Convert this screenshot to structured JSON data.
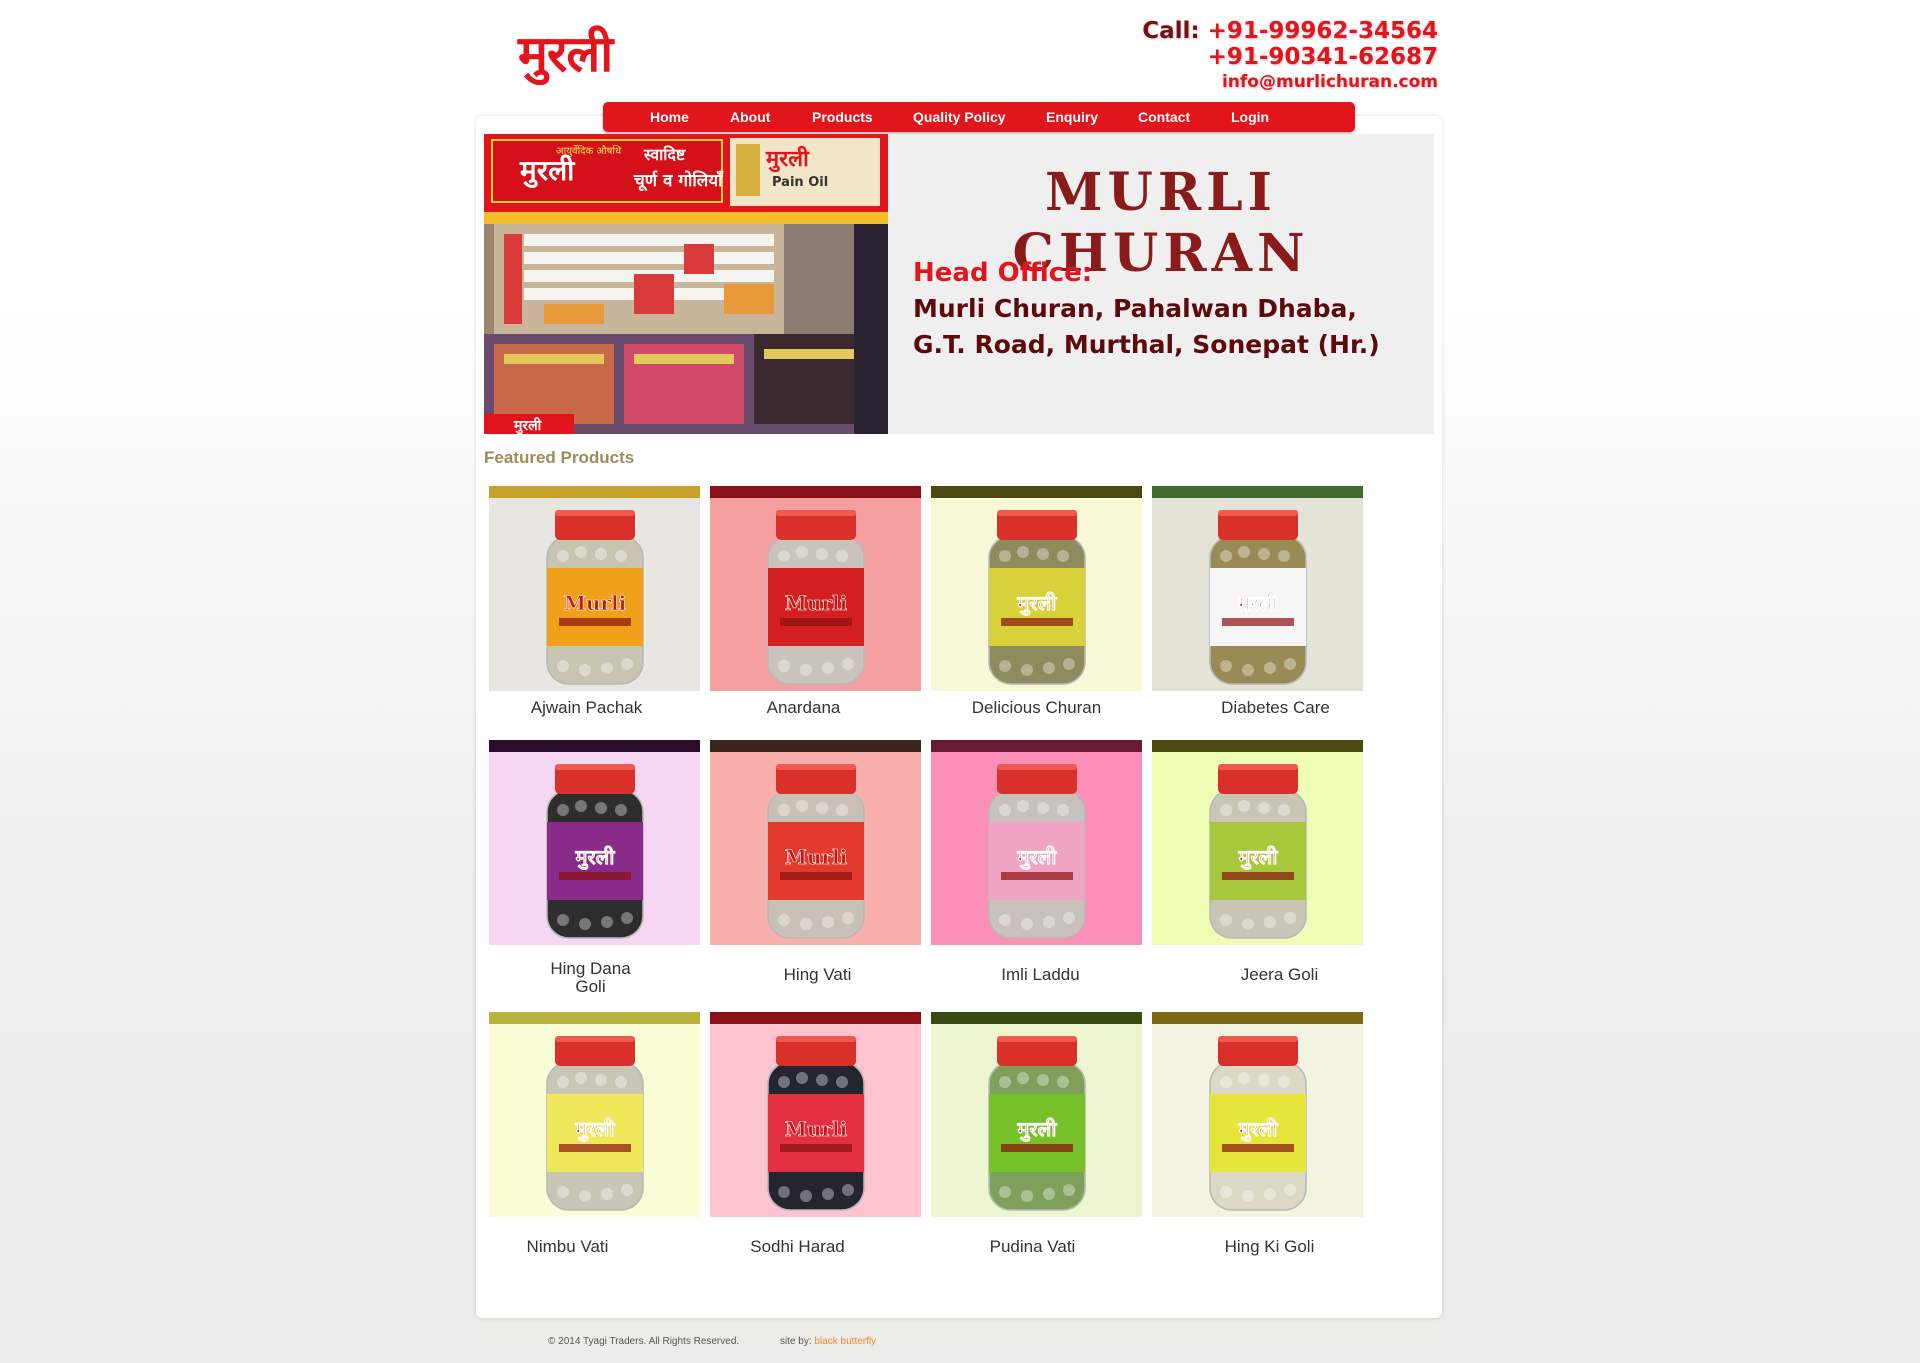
{
  "header": {
    "logo_text": "मुरली",
    "call_label": "Call:",
    "phone1": "+91-99962-34564",
    "phone2": "+91-90341-62687",
    "email": "info@murlichuran.com"
  },
  "nav": {
    "items": [
      {
        "label": "Home"
      },
      {
        "label": "About"
      },
      {
        "label": "Products"
      },
      {
        "label": "Quality Policy"
      },
      {
        "label": "Enquiry"
      },
      {
        "label": "Contact"
      },
      {
        "label": "Login"
      }
    ]
  },
  "banner": {
    "image_texts": [
      "आयुर्वेदिक औषधि",
      "मुरली",
      "स्वादिष्ट",
      "चूर्ण व गोलियाँ",
      "मुरली",
      "Pain Oil",
      "मुरली"
    ],
    "brand_title": "MURLI CHURAN",
    "office_label": "Head Office:",
    "office_line1": "Murli Churan, Pahalwan Dhaba,",
    "office_line2": "G.T. Road, Murthal, Sonepat (Hr.)"
  },
  "featured": {
    "heading": "Featured Products",
    "products": [
      {
        "name": "Ajwain Pachak",
        "label_text": "Murli",
        "stripe": "#c8a02c",
        "bg": "#e7e6e0",
        "label_color": "#f0a11a",
        "contents": "#c9c3b2"
      },
      {
        "name": "Anardana",
        "label_text": "Murli",
        "stripe": "#8c1018",
        "bg": "#f5a0a0",
        "label_color": "#d42020",
        "contents": "#c9c3bb"
      },
      {
        "name": "Delicious Churan",
        "label_text": "मुरली",
        "stripe": "#4d4a10",
        "bg": "#f9f8d6",
        "label_color": "#d7d23a",
        "contents": "#8e8b5c"
      },
      {
        "name": "Diabetes Care",
        "label_text": "मुरली",
        "stripe": "#3f6a30",
        "bg": "#e3e3d8",
        "label_color": "#f6f6f6",
        "contents": "#9a8b55"
      },
      {
        "name": "Hing Dana\nGoli",
        "label_text": "मुरली",
        "stripe": "#2a0e2a",
        "bg": "#f7d6f4",
        "label_color": "#8a2b8a",
        "contents": "#2e2e2e"
      },
      {
        "name": "Hing Vati",
        "label_text": "Murli",
        "stripe": "#3c2620",
        "bg": "#f8aeaa",
        "label_color": "#e23a2c",
        "contents": "#c9c1b8"
      },
      {
        "name": "Imli Laddu",
        "label_text": "मुरली",
        "stripe": "#6a1a35",
        "bg": "#fb8fb7",
        "label_color": "#f0a4c4",
        "contents": "#c9c1bd"
      },
      {
        "name": "Jeera Goli",
        "label_text": "मुरली",
        "stripe": "#4d4a10",
        "bg": "#eefdb4",
        "label_color": "#a6c83a",
        "contents": "#c9c5b7"
      },
      {
        "name": "Nimbu Vati",
        "label_text": "मुरली",
        "stripe": "#b6b43a",
        "bg": "#fafcd6",
        "label_color": "#efe85a",
        "contents": "#c9c5b7"
      },
      {
        "name": "Sodhi Harad",
        "label_text": "Murli",
        "stripe": "#8c1018",
        "bg": "#ffc4d0",
        "label_color": "#e23040",
        "contents": "#252530"
      },
      {
        "name": "Pudina Vati",
        "label_text": "मुरली",
        "stripe": "#3a4a14",
        "bg": "#ecf5cf",
        "label_color": "#78c02a",
        "contents": "#7ea05a"
      },
      {
        "name": "Hing Ki Goli",
        "label_text": "मुरली",
        "stripe": "#7a6a14",
        "bg": "#f3f3df",
        "label_color": "#e6e63a",
        "contents": "#ddd8c6"
      }
    ]
  },
  "footer": {
    "copyright": "© 2014 Tyagi Traders. All Rights Reserved.",
    "credit_label": "site by:",
    "credit_link": "black butterfly"
  }
}
